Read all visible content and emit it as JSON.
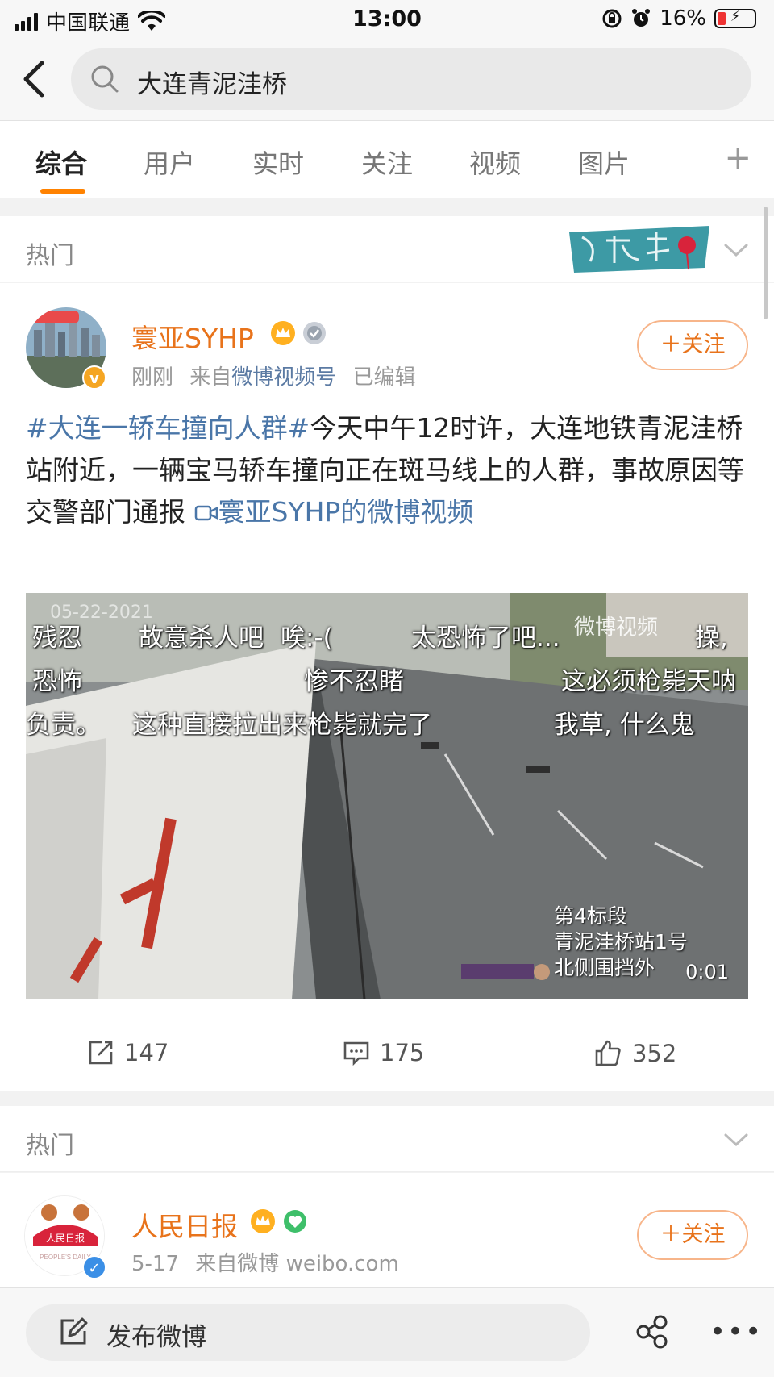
{
  "status_bar": {
    "carrier": "中国联通",
    "time": "13:00",
    "battery": "16%"
  },
  "search": {
    "query": "大连青泥洼桥"
  },
  "tabs": [
    {
      "label": "综合",
      "active": true
    },
    {
      "label": "用户"
    },
    {
      "label": "实时"
    },
    {
      "label": "关注"
    },
    {
      "label": "视频"
    },
    {
      "label": "图片"
    }
  ],
  "tab_plus": "+",
  "sections": [
    {
      "title": "热门"
    },
    {
      "title": "热门"
    }
  ],
  "post1": {
    "username": "寰亚SYHP",
    "time": "刚刚",
    "from_prefix": "来自",
    "source": "微博视频号",
    "edited": "已编辑",
    "follow_label": "＋关注",
    "hashtag": "#大连一轿车撞向人群#",
    "body": "今天中午12时许，大连地铁青泥洼桥站附近，一辆宝马轿车撞向正在斑马线上的人群，事故原因等交警部门通报",
    "video_link": "寰亚SYHP的微博视频",
    "video": {
      "danmaku": [
        "残忍",
        "故意杀人吧",
        "唉:-(",
        "太恐怖了吧...",
        "操,",
        "恐怖",
        "惨不忍睹",
        "这必须枪毙天呐",
        "负责。",
        "这种直接拉出来枪毙就完了",
        "我草, 什么鬼"
      ],
      "caption_line1": "第4标段",
      "caption_line2": "青泥洼桥站1号",
      "caption_line3": "北侧围挡外",
      "duration": "0:01",
      "watermark": "微博视频",
      "date": "05-22-2021"
    },
    "reposts": "147",
    "comments": "175",
    "likes": "352"
  },
  "post2": {
    "username": "人民日报",
    "time": "5-17",
    "from_prefix": "来自微博",
    "source": "weibo.com",
    "follow_label": "＋关注",
    "avatar_text": "人民日报",
    "avatar_sub": "PEOPLE'S DAILY"
  },
  "bottom_bar": {
    "compose_label": "发布微博"
  },
  "colors": {
    "accent": "#ff8200",
    "username": "#e8731b",
    "link": "#4a76a8"
  }
}
